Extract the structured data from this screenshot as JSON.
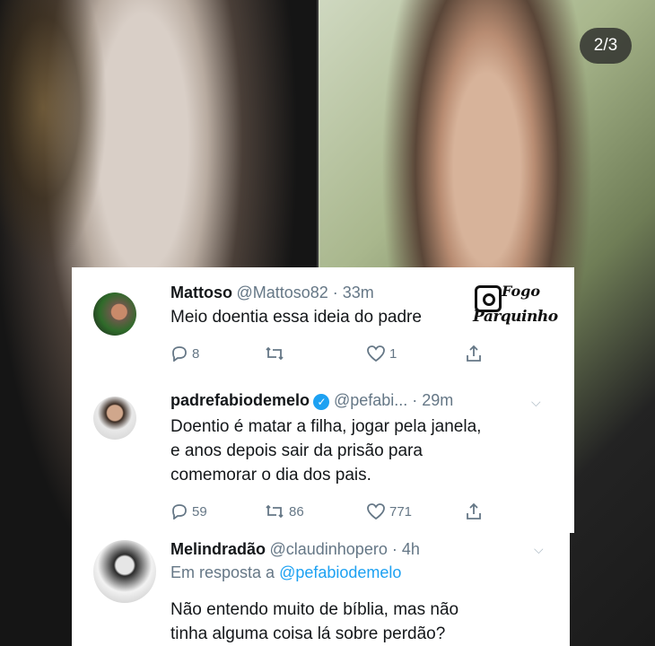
{
  "page_indicator": "2/3",
  "watermark": {
    "line1": "Fogo",
    "line2": "Parquinho",
    "mark": "No"
  },
  "tweets": [
    {
      "name": "Mattoso",
      "handle": "@Mattoso82 · 33m",
      "text": [
        "Meio doentia essa ideia do padre"
      ],
      "replies": "8",
      "retweets": "",
      "likes": "1"
    },
    {
      "name": "padrefabiodemelo",
      "handle": "@pefabi... · 29m",
      "verified": true,
      "text": [
        "Doentio é matar a filha, jogar pela janela,",
        "e anos depois sair da prisão para",
        "comemorar o dia dos pais."
      ],
      "replies": "59",
      "retweets": "86",
      "likes": "771"
    },
    {
      "name": "Melindradão",
      "handle": "@claudinhopero · 4h",
      "reply_prefix": "Em resposta a",
      "reply_to": "@pefabiodemelo",
      "text": [
        "Não entendo muito de bíblia, mas não",
        "tinha alguma coisa lá sobre perdão?"
      ]
    }
  ],
  "colors": {
    "twitter_blue": "#1da1f2",
    "gray": "#657786",
    "text": "#14171a"
  }
}
